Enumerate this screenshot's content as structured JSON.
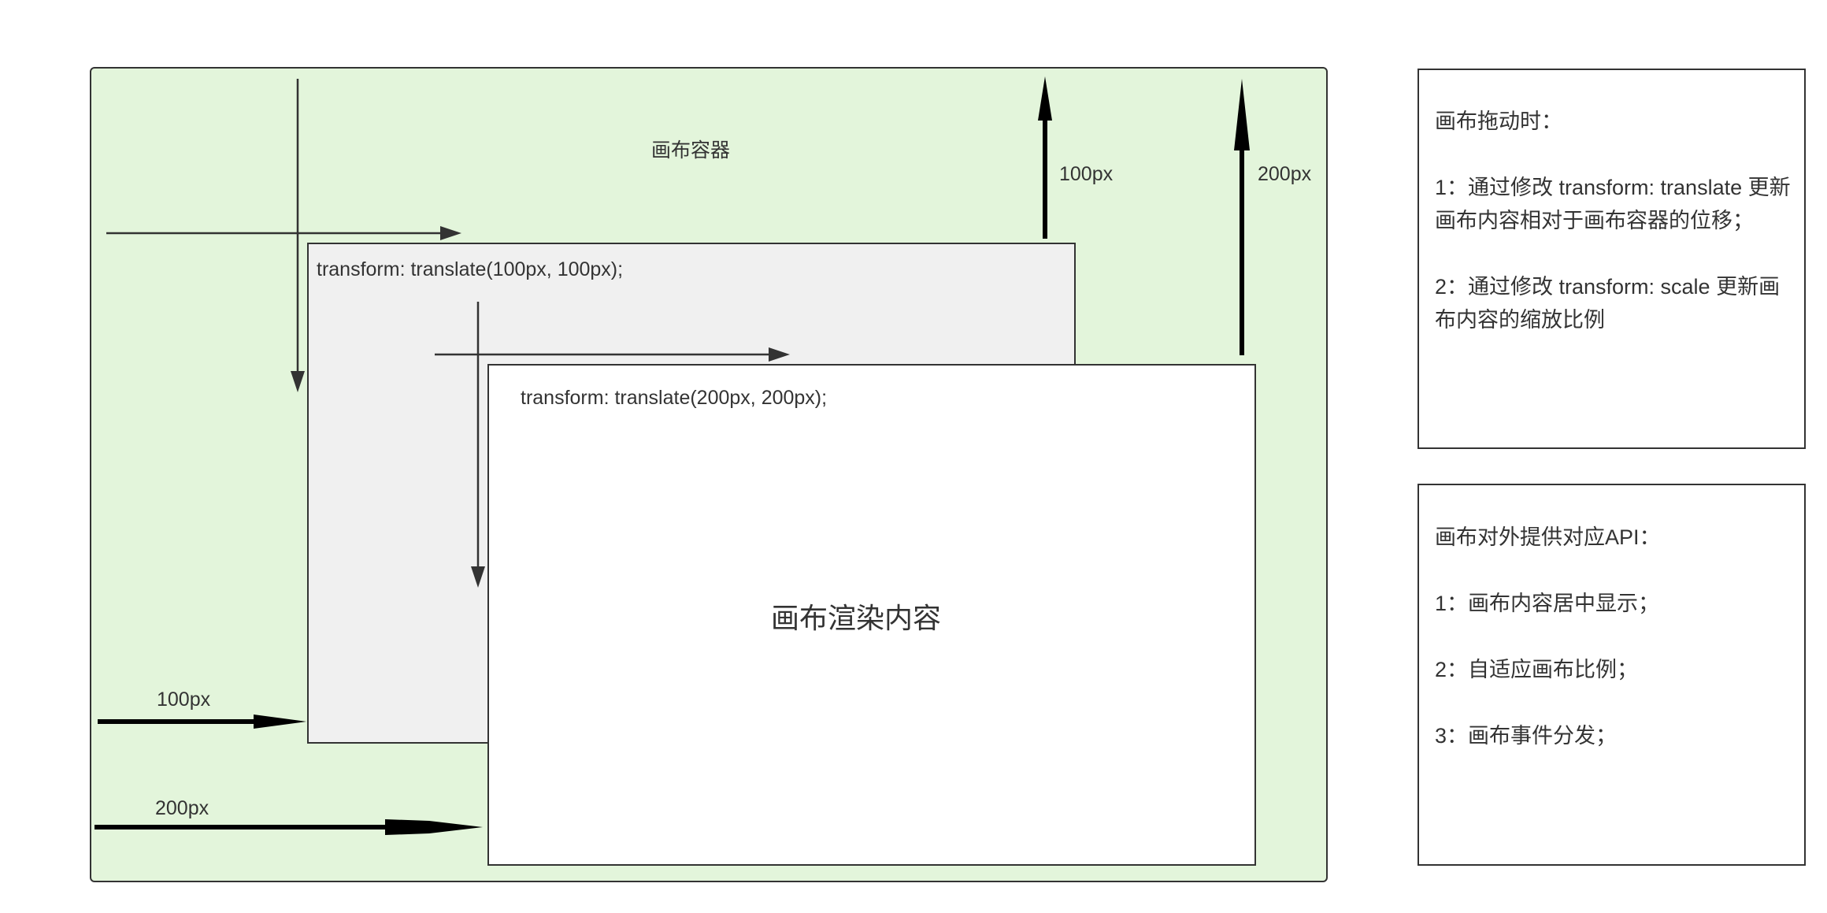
{
  "diagram": {
    "container": {
      "label": "画布容器"
    },
    "layer_1": {
      "transform_text": "transform: translate(100px, 100px);"
    },
    "layer_2": {
      "transform_text": "transform: translate(200px, 200px);",
      "content_label": "画布渲染内容"
    },
    "offset_labels": {
      "layer_1_vertical": "100px",
      "layer_2_vertical": "200px",
      "layer_1_horizontal": "100px",
      "layer_2_horizontal": "200px"
    }
  },
  "notes": [
    {
      "title": "画布拖动时：",
      "items": [
        "1：通过修改 transform: translate 更新画布内容相对于画布容器的位移；",
        "2：通过修改 transform: scale 更新画布内容的缩放比例"
      ]
    },
    {
      "title": "画布对外提供对应API：",
      "items": [
        "1：画布内容居中显示；",
        "2：自适应画布比例；",
        "3：画布事件分发；"
      ]
    }
  ],
  "colors": {
    "container_fill": "#e3f5db",
    "layer1_fill": "#f0f0f0",
    "layer2_fill": "#ffffff",
    "stroke": "#333333",
    "offset_arrow": "#000000"
  }
}
